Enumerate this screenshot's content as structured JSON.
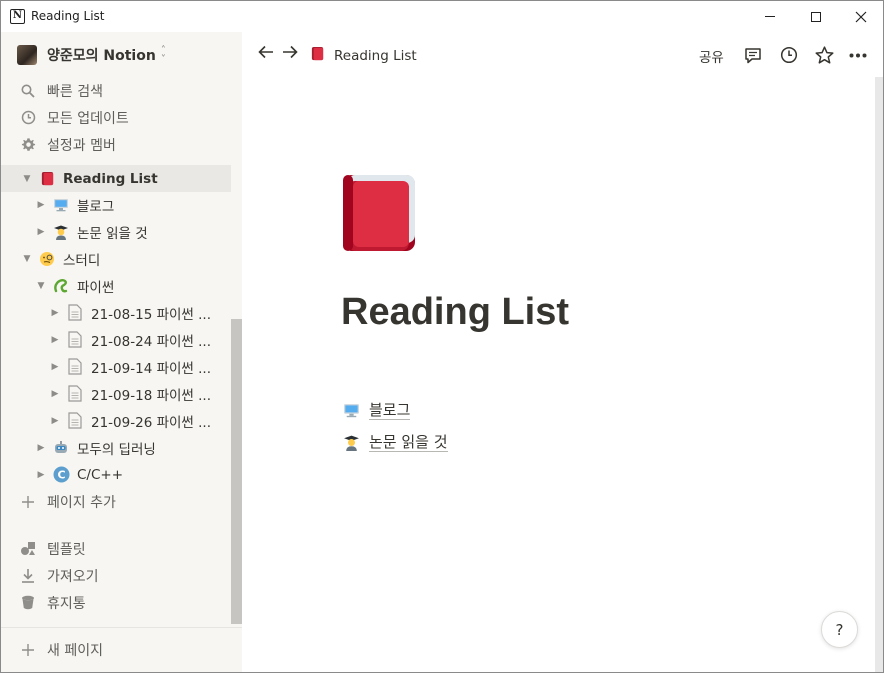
{
  "window": {
    "title": "Reading List",
    "app_icon_letter": "N"
  },
  "sidebar": {
    "workspace_name": "양준모의 Notion",
    "top_items": [
      {
        "icon": "search-icon",
        "label": "빠른 검색"
      },
      {
        "icon": "clock-icon",
        "label": "모든 업데이트"
      },
      {
        "icon": "gear-icon",
        "label": "설정과 멤버"
      }
    ],
    "tree": [
      {
        "label": "Reading List",
        "icon": "red-book-icon",
        "expanded": true,
        "selected": true,
        "depth": 0
      },
      {
        "label": "블로그",
        "icon": "computer-icon",
        "expanded": false,
        "depth": 1
      },
      {
        "label": "논문 읽을 것",
        "icon": "student-icon",
        "expanded": false,
        "depth": 1
      },
      {
        "label": "스터디",
        "icon": "monocle-face-icon",
        "expanded": true,
        "depth": 0
      },
      {
        "label": "파이썬",
        "icon": "python-icon",
        "expanded": true,
        "depth": 1
      },
      {
        "label": "21-08-15 파이썬 ...",
        "icon": "page-icon",
        "expanded": false,
        "depth": 2
      },
      {
        "label": "21-08-24 파이썬 ...",
        "icon": "page-icon",
        "expanded": false,
        "depth": 2
      },
      {
        "label": "21-09-14 파이썬 ...",
        "icon": "page-icon",
        "expanded": false,
        "depth": 2
      },
      {
        "label": "21-09-18 파이썬 ...",
        "icon": "page-icon",
        "expanded": false,
        "depth": 2
      },
      {
        "label": "21-09-26 파이썬 ...",
        "icon": "page-icon",
        "expanded": false,
        "depth": 2
      },
      {
        "label": "모두의 딥러닝",
        "icon": "robot-icon",
        "expanded": false,
        "depth": 1
      },
      {
        "label": "C/C++",
        "icon": "cpp-logo-icon",
        "expanded": false,
        "depth": 1
      }
    ],
    "add_page": "페이지 추가",
    "bottom_items": [
      {
        "icon": "shapes-icon",
        "label": "템플릿"
      },
      {
        "icon": "download-icon",
        "label": "가져오기"
      },
      {
        "icon": "trash-icon",
        "label": "휴지통"
      }
    ],
    "new_page": "새 페이지"
  },
  "topbar": {
    "breadcrumb": "Reading List",
    "share_label": "공유",
    "icons": [
      "comment-icon",
      "history-icon",
      "star-icon",
      "more-icon"
    ]
  },
  "page": {
    "title": "Reading List",
    "links": [
      {
        "icon": "computer-icon",
        "label": "블로그"
      },
      {
        "icon": "student-icon",
        "label": "논문 읽을 것"
      }
    ]
  },
  "help_label": "?",
  "colors": {
    "sidebar_bg": "#f7f6f3",
    "selected_bg": "#e9e8e4",
    "text": "#37352f",
    "muted": "#5f5e5b",
    "book_red": "#d8283e"
  }
}
